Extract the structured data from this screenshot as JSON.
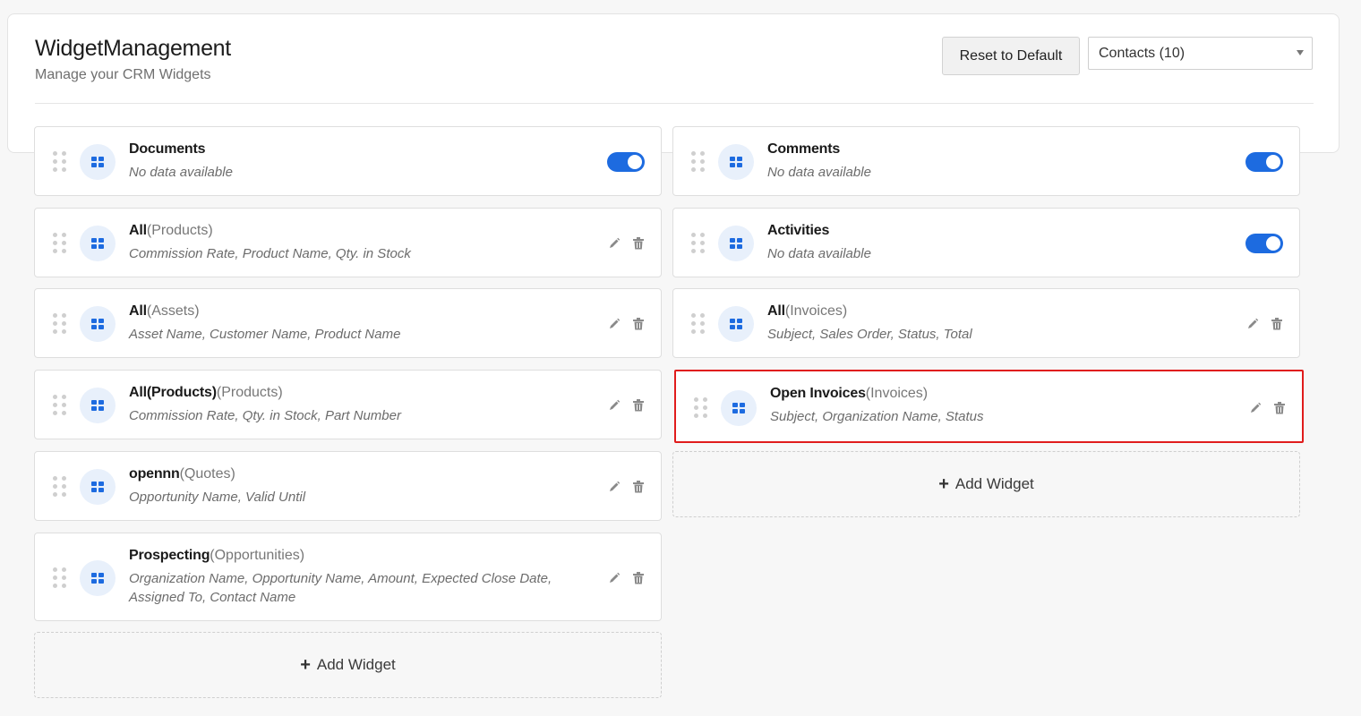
{
  "header": {
    "title": "WidgetManagement",
    "subtitle": "Manage your CRM Widgets",
    "reset_label": "Reset to Default",
    "module_select_value": "Contacts (10)"
  },
  "left_widgets": [
    {
      "name": "Documents",
      "module": "",
      "fields": "No data available",
      "control": "toggle",
      "enabled": true
    },
    {
      "name": "All",
      "module": "(Products)",
      "fields": "Commission Rate, Product Name, Qty. in Stock",
      "control": "edit-delete"
    },
    {
      "name": "All",
      "module": "(Assets)",
      "fields": "Asset Name, Customer Name, Product Name",
      "control": "edit-delete"
    },
    {
      "name": "All(Products)",
      "module": "(Products)",
      "fields": "Commission Rate, Qty. in Stock, Part Number",
      "control": "edit-delete"
    },
    {
      "name": "opennn",
      "module": "(Quotes)",
      "fields": "Opportunity Name, Valid Until",
      "control": "edit-delete"
    },
    {
      "name": "Prospecting",
      "module": "(Opportunities)",
      "fields": "Organization Name, Opportunity Name, Amount, Expected Close Date, Assigned To, Contact Name",
      "control": "edit-delete"
    }
  ],
  "right_widgets": [
    {
      "name": "Comments",
      "module": "",
      "fields": "No data available",
      "control": "toggle",
      "enabled": true
    },
    {
      "name": "Activities",
      "module": "",
      "fields": "No data available",
      "control": "toggle",
      "enabled": true
    },
    {
      "name": "All",
      "module": "(Invoices)",
      "fields": "Subject, Sales Order, Status, Total",
      "control": "edit-delete"
    },
    {
      "name": "Open Invoices",
      "module": "(Invoices)",
      "fields": "Subject, Organization Name, Status",
      "control": "edit-delete",
      "highlighted": true
    }
  ],
  "add_widget_label": "Add Widget",
  "colors": {
    "accent": "#1d6be0",
    "highlight": "#e01c1c",
    "icon_bg": "#e8f0fb"
  },
  "icons": {
    "drag": "drag-handle-icon",
    "widget": "grid-icon",
    "edit": "pencil-icon",
    "delete": "trash-icon",
    "add": "plus-icon"
  }
}
